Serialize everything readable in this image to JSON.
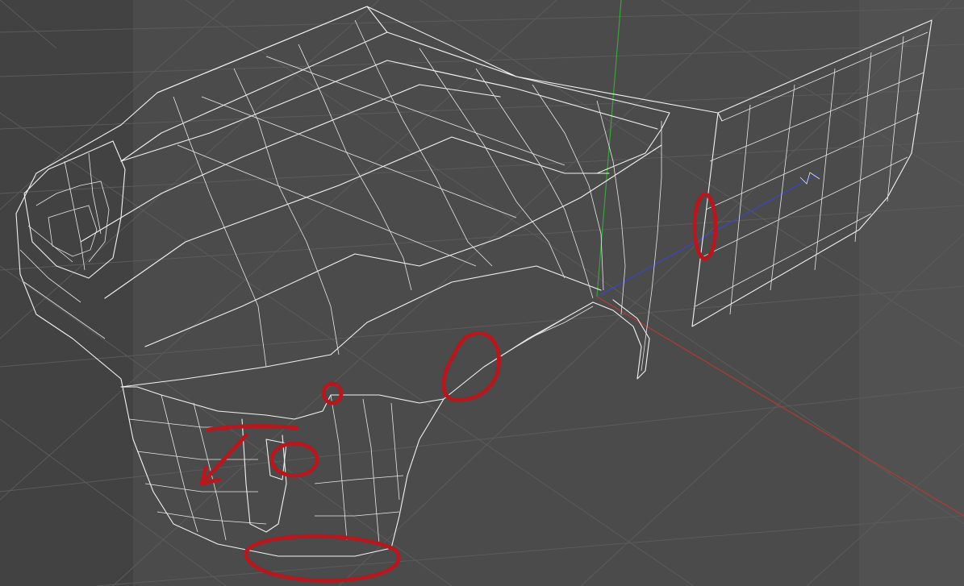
{
  "viewport": {
    "view": "perspective",
    "background": "#4a4a4a",
    "grid_color": "#5b5b5b",
    "wireframe_color": "#f2f2f2"
  },
  "axes": {
    "x_color": "#b13a33",
    "y_color": "#3aa43a",
    "z_color": "#3946c8"
  },
  "annotations": {
    "color": "#b3191e",
    "count": 6
  }
}
